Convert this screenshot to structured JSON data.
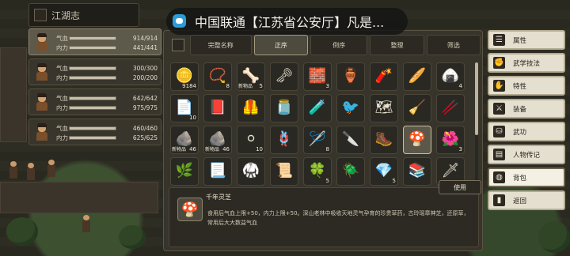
{
  "top_bar": {
    "title": "江湖志"
  },
  "notification": {
    "text": "中国联通【江苏省公安厅】凡是..."
  },
  "party": [
    {
      "hp_label": "气血",
      "hp": "914/914",
      "hp_fraction": 1.0,
      "mp_label": "内力",
      "mp": "441/441",
      "mp_fraction": 1.0
    },
    {
      "hp_label": "气血",
      "hp": "300/300",
      "hp_fraction": 1.0,
      "mp_label": "内力",
      "mp": "200/200",
      "mp_fraction": 1.0
    },
    {
      "hp_label": "气血",
      "hp": "642/642",
      "hp_fraction": 1.0,
      "mp_label": "内力",
      "mp": "975/975",
      "mp_fraction": 1.0
    },
    {
      "hp_label": "气血",
      "hp": "460/460",
      "hp_fraction": 1.0,
      "mp_label": "内力",
      "mp": "625/625",
      "mp_fraction": 1.0
    }
  ],
  "inventory": {
    "toolbar": {
      "full_name": "完整名称",
      "ascending": "正序",
      "descending": "倒序",
      "organize": "整理",
      "filter": "筛选"
    },
    "slots": [
      {
        "icon": "coin-string-icon",
        "glyph": "🪙",
        "qty": "9184",
        "badge": "",
        "tag": ""
      },
      {
        "icon": "red-beads-icon",
        "glyph": "📿",
        "qty": "8",
        "badge": "",
        "tag": ""
      },
      {
        "icon": "bone-icon",
        "glyph": "🦴",
        "qty": "5",
        "badge": "新物品",
        "tag": ""
      },
      {
        "icon": "key-icon",
        "glyph": "🗝",
        "qty": "",
        "badge": "",
        "tag": ""
      },
      {
        "icon": "ink-stone-icon",
        "glyph": "🧱",
        "qty": "3",
        "badge": "",
        "tag": ""
      },
      {
        "icon": "wine-jar-icon",
        "glyph": "🏺",
        "qty": "",
        "badge": "",
        "tag": ""
      },
      {
        "icon": "firecracker-icon",
        "glyph": "🧨",
        "qty": "",
        "badge": "",
        "tag": ""
      },
      {
        "icon": "scroll-stick-icon",
        "glyph": "🥖",
        "qty": "",
        "badge": "",
        "tag": ""
      },
      {
        "icon": "steamed-bun-icon",
        "glyph": "🍙",
        "qty": "4",
        "badge": "",
        "tag": ""
      },
      {
        "icon": "paper-icon",
        "glyph": "📄",
        "qty": "10",
        "badge": "",
        "tag": ""
      },
      {
        "icon": "book-icon",
        "glyph": "📕",
        "qty": "",
        "badge": "",
        "tag": ""
      },
      {
        "icon": "armor-icon",
        "glyph": "🦺",
        "qty": "",
        "badge": "",
        "tag": ""
      },
      {
        "icon": "jar-icon",
        "glyph": "🫙",
        "qty": "",
        "badge": "",
        "tag": ""
      },
      {
        "icon": "potion-icon",
        "glyph": "🧪",
        "qty": "",
        "badge": "",
        "tag": ""
      },
      {
        "icon": "blue-bird-icon",
        "glyph": "🐦",
        "qty": "",
        "badge": "",
        "tag": ""
      },
      {
        "icon": "map-icon",
        "glyph": "🗺",
        "qty": "",
        "badge": "",
        "tag": ""
      },
      {
        "icon": "broom-icon",
        "glyph": "🧹",
        "qty": "",
        "badge": "",
        "tag": ""
      },
      {
        "icon": "staff-icon",
        "glyph": "🥢",
        "qty": "",
        "badge": "",
        "tag": ""
      },
      {
        "icon": "ore-icon",
        "glyph": "🪨",
        "qty": "46",
        "badge": "新物品",
        "tag": ""
      },
      {
        "icon": "green-ore-icon",
        "glyph": "🪨",
        "qty": "46",
        "badge": "新物品",
        "tag": ""
      },
      {
        "icon": "pebbles-icon",
        "glyph": "⚪",
        "qty": "10",
        "badge": "",
        "tag": ""
      },
      {
        "icon": "rope-icon",
        "glyph": "🪢",
        "qty": "",
        "badge": "",
        "tag": ""
      },
      {
        "icon": "needles-icon",
        "glyph": "🪡",
        "qty": "8",
        "badge": "",
        "tag": ""
      },
      {
        "icon": "cleaver-icon",
        "glyph": "🔪",
        "qty": "",
        "badge": "",
        "tag": ""
      },
      {
        "icon": "boot-icon",
        "glyph": "🥾",
        "qty": "",
        "badge": "",
        "tag": ""
      },
      {
        "icon": "mushroom-icon",
        "glyph": "🍄",
        "qty": "",
        "badge": "",
        "tag": ""
      },
      {
        "icon": "red-flower-icon",
        "glyph": "🌺",
        "qty": "3",
        "badge": "",
        "tag": ""
      },
      {
        "icon": "blue-herb-icon",
        "glyph": "🌿",
        "qty": "",
        "badge": "",
        "tag": ""
      },
      {
        "icon": "paper-stack-icon",
        "glyph": "📃",
        "qty": "",
        "badge": "",
        "tag": ""
      },
      {
        "icon": "cloth-armor-icon",
        "glyph": "🥋",
        "qty": "",
        "badge": "",
        "tag": ""
      },
      {
        "icon": "parchment-icon",
        "glyph": "📜",
        "qty": "",
        "badge": "",
        "tag": ""
      },
      {
        "icon": "jade-icon",
        "glyph": "🍀",
        "qty": "5",
        "badge": "",
        "tag": ""
      },
      {
        "icon": "beetle-icon",
        "glyph": "🪲",
        "qty": "",
        "badge": "",
        "tag": ""
      },
      {
        "icon": "crystal-icon",
        "glyph": "💎",
        "qty": "5",
        "badge": "",
        "tag": ""
      },
      {
        "icon": "scroll-bundle-icon",
        "glyph": "📚",
        "qty": "",
        "badge": "",
        "tag": ""
      },
      {
        "icon": "dagger-icon",
        "glyph": "🗡",
        "qty": "",
        "badge": "",
        "tag": ""
      }
    ],
    "use_label": "使用",
    "detail": {
      "name": "千年灵芝",
      "icon": "mushroom-icon",
      "glyph": "🍄",
      "description": "食用后气血上限+50，内力上限+50。深山老林中吸收天地灵气孕育的珍贵草药，古玲瑶章神芝，还原草，常用后大大数益气血"
    }
  },
  "right_menu": [
    {
      "label": "属性",
      "icon": "attribute-icon",
      "glyph": "☰"
    },
    {
      "label": "武学技法",
      "icon": "martial-art-icon",
      "glyph": "✊"
    },
    {
      "label": "特性",
      "icon": "trait-icon",
      "glyph": "✋"
    },
    {
      "label": "装备",
      "icon": "equipment-icon",
      "glyph": "⚔"
    },
    {
      "label": "武功",
      "icon": "kungfu-icon",
      "glyph": "⛁"
    },
    {
      "label": "人物传记",
      "icon": "biography-icon",
      "glyph": "▤"
    },
    {
      "label": "背包",
      "icon": "bag-icon",
      "glyph": "◍"
    },
    {
      "label": "返回",
      "icon": "return-icon",
      "glyph": "▮"
    }
  ]
}
